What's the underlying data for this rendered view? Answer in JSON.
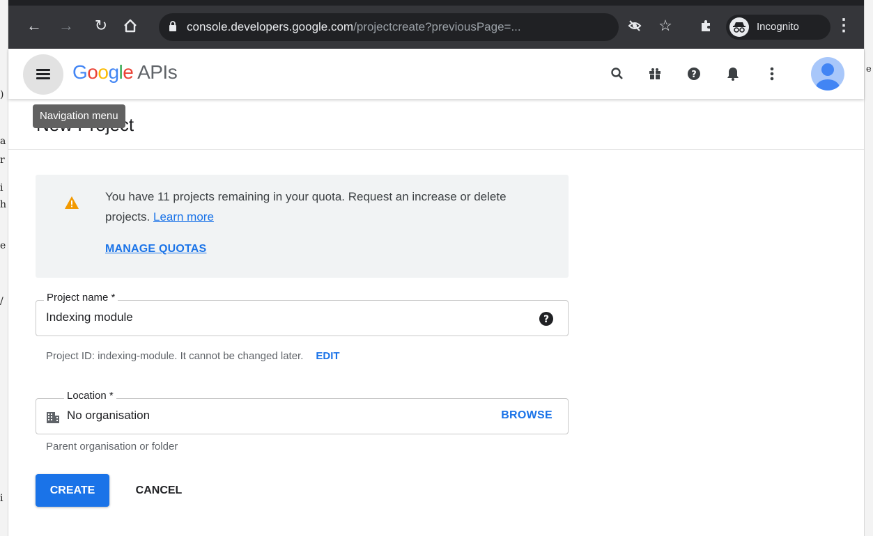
{
  "browser": {
    "url_domain": "console.developers.google.com",
    "url_path": "/projectcreate?previousPage=...",
    "incognito_label": "Incognito"
  },
  "header": {
    "brand_google": "Google",
    "brand_apis": " APIs",
    "tooltip": "Navigation menu"
  },
  "page": {
    "title": "New Project"
  },
  "quota": {
    "message": "You have 11 projects remaining in your quota. Request an increase or delete projects.",
    "learn_more": "Learn more",
    "manage_quotas": "MANAGE QUOTAS"
  },
  "project_name": {
    "label": "Project name *",
    "value": "Indexing module",
    "hint": "Project ID: indexing-module. It cannot be changed later.",
    "edit": "EDIT"
  },
  "location": {
    "label": "Location *",
    "value": "No organisation",
    "browse": "BROWSE",
    "hint": "Parent organisation or folder"
  },
  "actions": {
    "create": "CREATE",
    "cancel": "CANCEL"
  },
  "colors": {
    "accent": "#1a73e8",
    "warning": "#f29900"
  }
}
